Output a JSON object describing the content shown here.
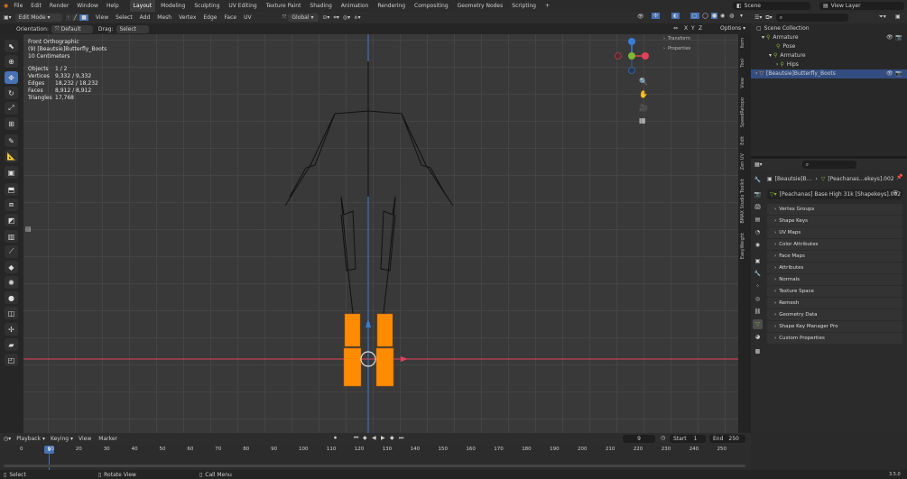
{
  "menus": [
    "File",
    "Edit",
    "Render",
    "Window",
    "Help"
  ],
  "workspaces": [
    {
      "label": "Layout",
      "active": true
    },
    {
      "label": "Modeling"
    },
    {
      "label": "Sculpting"
    },
    {
      "label": "UV Editing"
    },
    {
      "label": "Texture Paint"
    },
    {
      "label": "Shading"
    },
    {
      "label": "Animation"
    },
    {
      "label": "Rendering"
    },
    {
      "label": "Compositing"
    },
    {
      "label": "Geometry Nodes"
    },
    {
      "label": "Scripting"
    },
    {
      "label": "+"
    }
  ],
  "scene": {
    "label": "Scene",
    "view_layer": "View Layer"
  },
  "header": {
    "mode": "Edit Mode",
    "menus": [
      "View",
      "Select",
      "Add",
      "Mesh",
      "Vertex",
      "Edge",
      "Face",
      "UV"
    ],
    "transform_orientation": "Global"
  },
  "tool_settings": {
    "orientation_label": "Orientation:",
    "orientation_value": "Default",
    "drag_label": "Drag:",
    "drag_value": "Select Box",
    "axes": [
      "X",
      "Y",
      "Z"
    ],
    "options": "Options"
  },
  "viewport": {
    "view_name": "Front Orthographic",
    "object_name": "(9) [Beautsie]Butterfly_Boots",
    "scale": "10 Centimeters",
    "stats": [
      {
        "label": "Objects",
        "value": "1 / 2"
      },
      {
        "label": "Vertices",
        "value": "9,332 / 9,332"
      },
      {
        "label": "Edges",
        "value": "18,232 / 18,232"
      },
      {
        "label": "Faces",
        "value": "8,912 / 8,912"
      },
      {
        "label": "Triangles",
        "value": "17,768"
      }
    ]
  },
  "npanel": {
    "sections": [
      "Transform",
      "Properties"
    ]
  },
  "side_tabs": [
    "Item",
    "Tool",
    "View",
    "SpeedRetopo",
    "Edit",
    "Zen UV",
    "BMAX Studio Toolkit",
    "EasyWeight"
  ],
  "outliner": {
    "root": "Scene Collection",
    "items": [
      {
        "label": "Armature"
      },
      {
        "label": "Pose"
      },
      {
        "label": "Armature"
      },
      {
        "label": "Hips"
      },
      {
        "label": "[Beautsie]Butterfly_Boots"
      }
    ]
  },
  "properties": {
    "breadcrumb_a": "[Beautsie]B...",
    "breadcrumb_b": "[Peachanas...ekeys].002",
    "datablock": "[Peachanas] Base High 31k [Shapekeys].002",
    "sections": [
      "Vertex Groups",
      "Shape Keys",
      "UV Maps",
      "Color Attributes",
      "Face Maps",
      "Attributes",
      "Normals",
      "Texture Space",
      "Remesh",
      "Geometry Data",
      "Shape Key Manager Pro",
      "Custom Properties"
    ]
  },
  "timeline": {
    "menus": [
      "Playback",
      "Keying",
      "View",
      "Marker"
    ],
    "current_frame": "9",
    "start_label": "Start",
    "start": "1",
    "end_label": "End",
    "end": "250",
    "ticks": [
      "0",
      "10",
      "20",
      "30",
      "40",
      "50",
      "60",
      "70",
      "80",
      "90",
      "100",
      "110",
      "120",
      "130",
      "140",
      "150",
      "160",
      "170",
      "180",
      "190",
      "200",
      "210",
      "220",
      "230",
      "240",
      "250"
    ]
  },
  "statusbar": {
    "select": "Select",
    "rotate": "Rotate View",
    "menu": "Call Menu",
    "version": "3.5.0"
  },
  "colors": {
    "accent": "#4772b3",
    "selection": "#ff8c00",
    "x_axis": "#e2415a",
    "y_axis": "#7fb832",
    "z_axis": "#3a7cd8"
  }
}
